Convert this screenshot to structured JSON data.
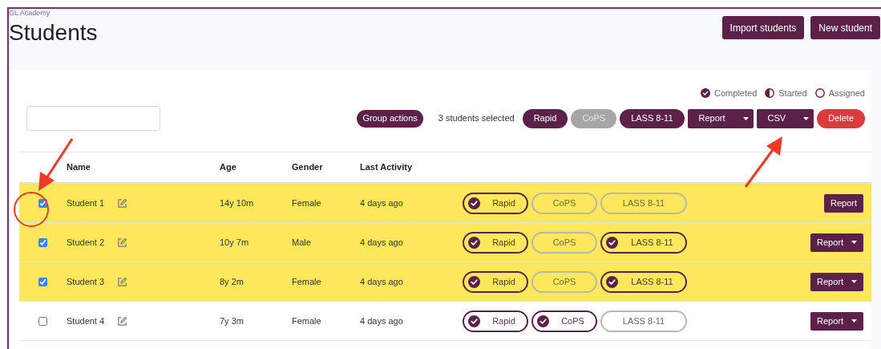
{
  "breadcrumb": "GL Academy",
  "title": "Students",
  "header_buttons": [
    "Import students",
    "New student"
  ],
  "legend": [
    {
      "kind": "completed",
      "label": "Completed"
    },
    {
      "kind": "started",
      "label": "Started"
    },
    {
      "kind": "assigned",
      "label": "Assigned"
    }
  ],
  "toolbar": {
    "group_actions": "Group actions",
    "selection_text": "3 students selected",
    "test_buttons": [
      {
        "label": "Rapid",
        "disabled": false
      },
      {
        "label": "CoPS",
        "disabled": true
      },
      {
        "label": "LASS 8-11",
        "disabled": false
      }
    ],
    "dropdown_buttons": [
      "Report",
      "CSV"
    ],
    "delete": "Delete"
  },
  "table": {
    "columns": [
      "Name",
      "Age",
      "Gender",
      "Last Activity"
    ],
    "rows": [
      {
        "selected": true,
        "checked": true,
        "name": "Student 1",
        "age": "14y 10m",
        "gender": "Female",
        "last_activity": "4 days ago",
        "tests": [
          {
            "label": "Rapid",
            "completed": true
          },
          {
            "label": "CoPS",
            "completed": false
          },
          {
            "label": "LASS 8-11",
            "completed": false
          }
        ],
        "report": "Report",
        "dropdown": false
      },
      {
        "selected": true,
        "checked": true,
        "name": "Student 2",
        "age": "10y 7m",
        "gender": "Male",
        "last_activity": "4 days ago",
        "tests": [
          {
            "label": "Rapid",
            "completed": true
          },
          {
            "label": "CoPS",
            "completed": false
          },
          {
            "label": "LASS 8-11",
            "completed": true
          }
        ],
        "report": "Report",
        "dropdown": true
      },
      {
        "selected": true,
        "checked": true,
        "name": "Student 3",
        "age": "8y 2m",
        "gender": "Female",
        "last_activity": "4 days ago",
        "tests": [
          {
            "label": "Rapid",
            "completed": true
          },
          {
            "label": "CoPS",
            "completed": false
          },
          {
            "label": "LASS 8-11",
            "completed": true
          }
        ],
        "report": "Report",
        "dropdown": true
      },
      {
        "selected": false,
        "checked": false,
        "name": "Student 4",
        "age": "7y 3m",
        "gender": "Female",
        "last_activity": "4 days ago",
        "tests": [
          {
            "label": "Rapid",
            "completed": true
          },
          {
            "label": "CoPS",
            "completed": true
          },
          {
            "label": "LASS 8-11",
            "completed": false
          }
        ],
        "report": "Report",
        "dropdown": true
      }
    ]
  }
}
